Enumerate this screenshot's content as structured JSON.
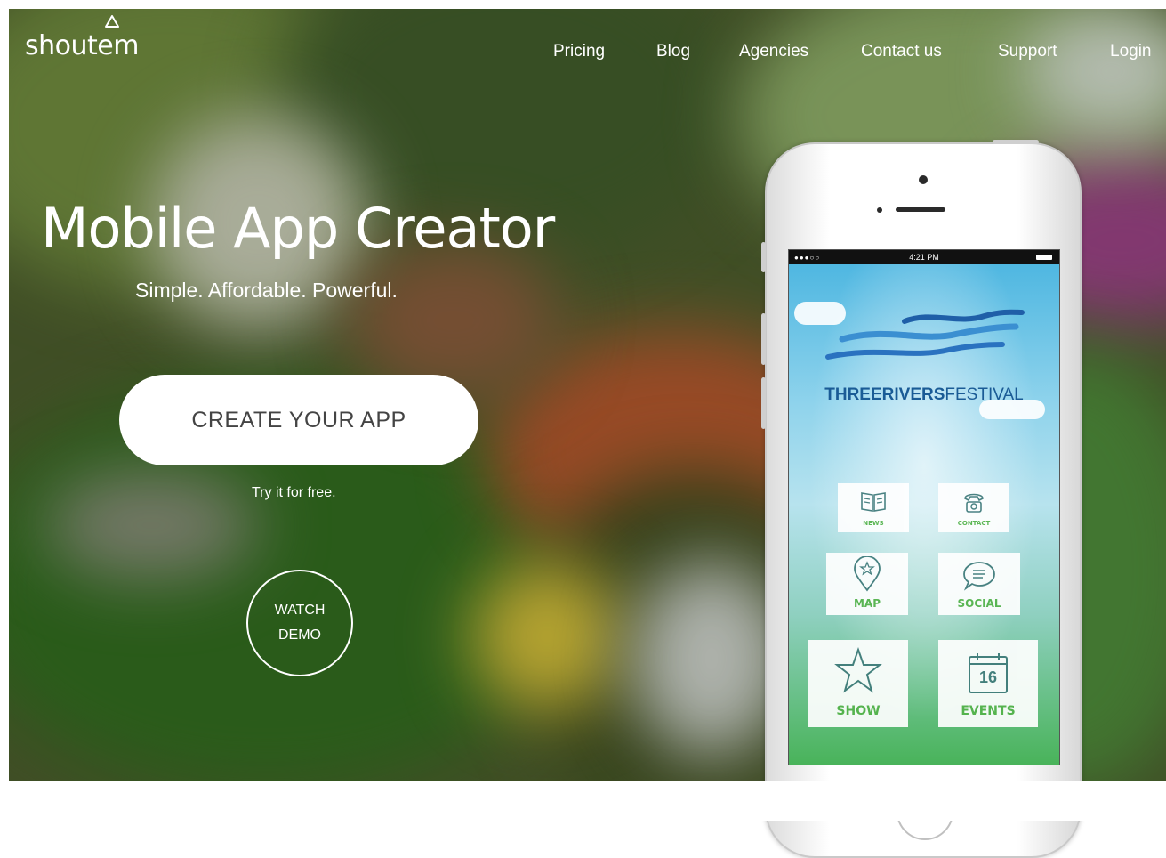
{
  "brand": {
    "logo_text": "shoutem"
  },
  "nav": {
    "items": [
      {
        "label": "Pricing"
      },
      {
        "label": "Blog"
      },
      {
        "label": "Agencies"
      },
      {
        "label": "Contact us"
      },
      {
        "label": "Support"
      },
      {
        "label": "Login"
      }
    ]
  },
  "hero": {
    "headline": "Mobile App Creator",
    "tagline": "Simple. Affordable. Powerful.",
    "cta_label": "CREATE YOUR APP",
    "cta_sub": "Try it for free.",
    "demo_line1": "WATCH",
    "demo_line2": "DEMO"
  },
  "phone": {
    "time": "4:21 PM",
    "app_title_bold": "THREERIVERS",
    "app_title_light": "FESTIVAL",
    "tiles": [
      {
        "label": "NEWS",
        "icon": "book-icon"
      },
      {
        "label": "CONTACT",
        "icon": "telephone-icon"
      },
      {
        "label": "MAP",
        "icon": "map-pin-star-icon"
      },
      {
        "label": "SOCIAL",
        "icon": "chat-bubble-icon"
      },
      {
        "label": "SHOW",
        "icon": "star-icon"
      },
      {
        "label": "EVENTS",
        "icon": "calendar-icon",
        "day": "16"
      }
    ]
  },
  "colors": {
    "tile_text": "#54b34a",
    "festival_blue": "#1a5b96",
    "cta_bg": "#ffffff"
  }
}
